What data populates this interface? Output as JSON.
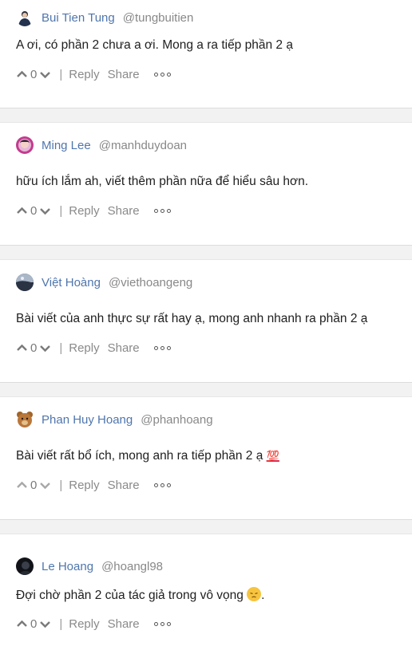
{
  "comments": [
    {
      "name": "Bui Tien Tung",
      "handle": "@tungbuitien",
      "text": "A ơi, có phần 2 chưa a ơi. Mong a ra tiếp phần 2 ạ",
      "votes": "0",
      "reply": "Reply",
      "share": "Share"
    },
    {
      "name": "Ming Lee",
      "handle": "@manhduydoan",
      "text": "hữu ích lắm ah, viết thêm phần nữa để hiểu sâu hơn.",
      "votes": "0",
      "reply": "Reply",
      "share": "Share"
    },
    {
      "name": "Việt Hoàng",
      "handle": "@viethoangeng",
      "text": "Bài viết của anh thực sự rất hay ạ, mong anh nhanh ra phần 2 ạ",
      "votes": "0",
      "reply": "Reply",
      "share": "Share"
    },
    {
      "name": "Phan Huy Hoang",
      "handle": "@phanhoang",
      "text": "Bài viết rất bổ ích, mong anh ra tiếp phần 2 ạ",
      "emoji": "💯",
      "votes": "0",
      "reply": "Reply",
      "share": "Share"
    },
    {
      "name": "Le Hoang",
      "handle": "@hoangl98",
      "text": "Đợi chờ phần 2 của tác giả trong vô vọng",
      "emoji": "😔",
      "text_suffix": ".",
      "votes": "0",
      "reply": "Reply",
      "share": "Share"
    }
  ],
  "colors": {
    "name": "#4f76ad",
    "handle": "#888888",
    "separator": "#f2f2f2"
  },
  "icons": {
    "upvote": "chevron-up-icon",
    "downvote": "chevron-down-icon",
    "more": "more-horizontal-icon"
  },
  "separator_char": "|"
}
